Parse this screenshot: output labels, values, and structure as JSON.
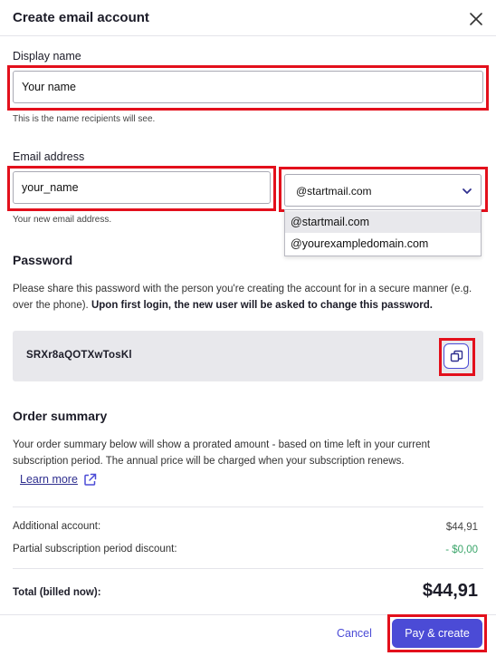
{
  "dialog": {
    "title": "Create email account"
  },
  "display_name": {
    "label": "Display name",
    "value": "Your name",
    "hint": "This is the name recipients will see."
  },
  "email": {
    "label": "Email address",
    "value": "your_name",
    "hint": "Your new email address.",
    "domain_selected": "@startmail.com",
    "domain_options": [
      "@startmail.com",
      "@yourexampledomain.com"
    ]
  },
  "password": {
    "title": "Password",
    "description": "Please share this password with the person you're creating the account for in a secure manner (e.g. over the phone).",
    "description_bold": "Upon first login, the new user will be asked to change this password.",
    "value": "SRXr8aQOTXwTosKl",
    "copy_icon": "copy-icon"
  },
  "order": {
    "title": "Order summary",
    "description": "Your order summary below will show a prorated amount - based on time left in your current subscription period. The annual price will be charged when your subscription renews.",
    "learn_more": "Learn more",
    "rows": [
      {
        "label": "Additional account:",
        "value": "$44,91"
      },
      {
        "label": "Partial subscription period discount:",
        "value": "- $0,00"
      }
    ],
    "total_label": "Total (billed now):",
    "total_value": "$44,91"
  },
  "footer": {
    "cancel_label": "Cancel",
    "pay_label": "Pay & create"
  },
  "colors": {
    "accent": "#4b4bd6",
    "highlight": "#e3101c",
    "discount": "#3ca66b",
    "panel": "#e8e8ec"
  }
}
